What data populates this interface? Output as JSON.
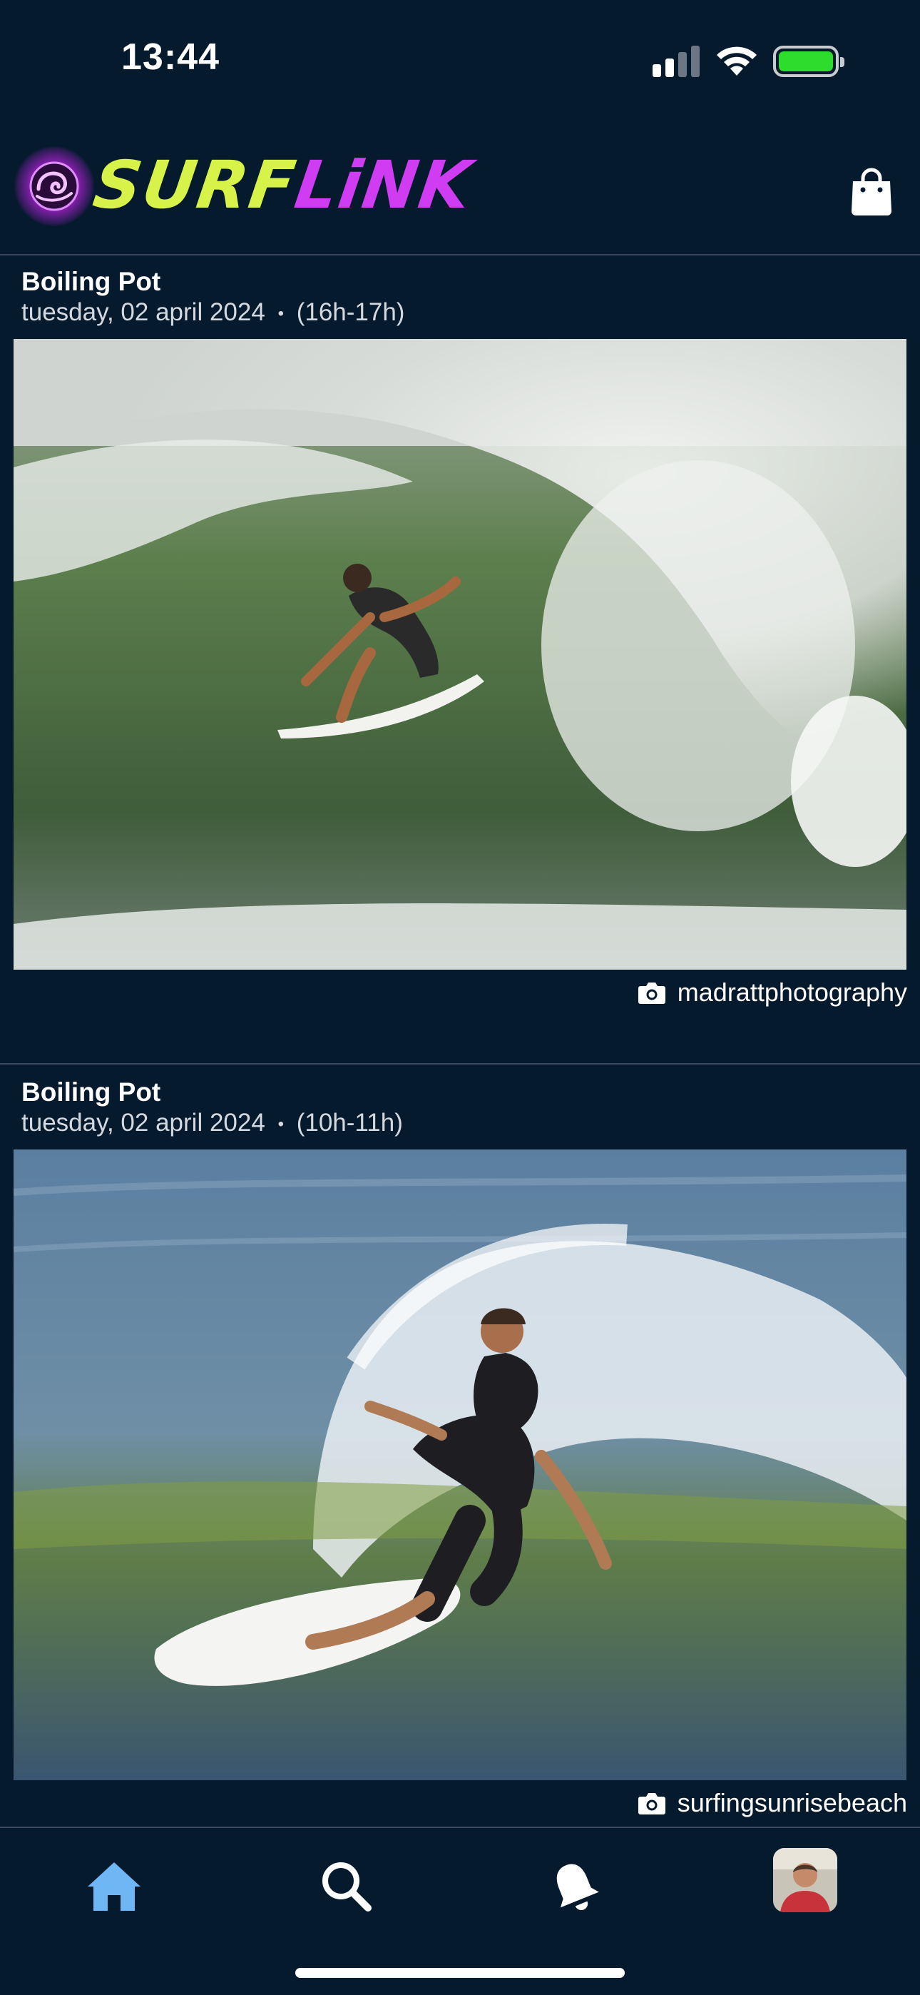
{
  "status_bar": {
    "time": "13:44",
    "battery_color": "#2ddc2d"
  },
  "header": {
    "logo_text_part1": "SURF",
    "logo_text_part2": "LiNK",
    "logo_color_1": "#d7f34a",
    "logo_color_2": "#d03cf2",
    "icons": [
      "surflink-logo-icon",
      "shopping-bag-icon"
    ]
  },
  "posts": [
    {
      "spot": "Boiling Pot",
      "date": "tuesday, 02 april 2024",
      "separator": "•",
      "session": "(16h-17h)",
      "photo_subject": "surfer-in-barrel-photo",
      "photographer": "madrattphotography"
    },
    {
      "spot": "Boiling Pot",
      "date": "tuesday, 02 april 2024",
      "separator": "•",
      "session": "(10h-11h)",
      "photo_subject": "surfer-carving-photo",
      "photographer": "surfingsunrisebeach"
    }
  ],
  "tab_bar": {
    "active_color": "#6fb6f5",
    "tabs": [
      "home-icon",
      "search-icon",
      "notifications-bell-icon",
      "profile-avatar"
    ]
  }
}
